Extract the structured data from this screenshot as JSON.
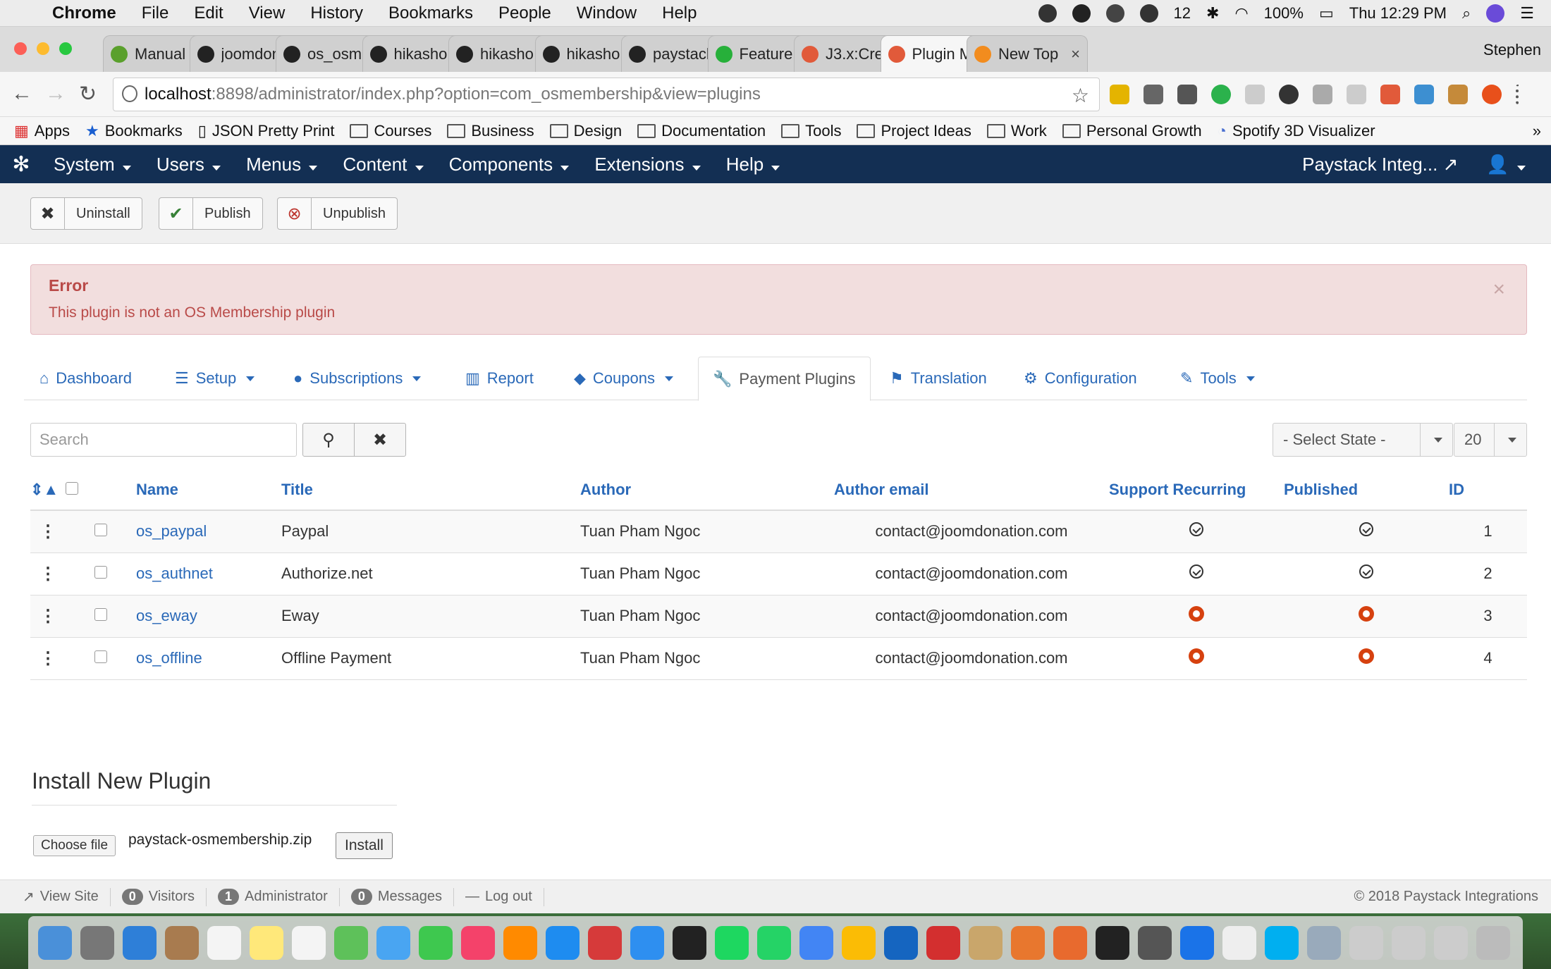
{
  "menubar": {
    "app": "Chrome",
    "items": [
      "File",
      "Edit",
      "View",
      "History",
      "Bookmarks",
      "People",
      "Window",
      "Help"
    ],
    "notification_count": "12",
    "battery": "100%",
    "clock": "Thu 12:29 PM"
  },
  "tabs": [
    {
      "label": "Manual",
      "icon": "leaf-icon"
    },
    {
      "label": "joomdon",
      "icon": "github-icon"
    },
    {
      "label": "os_osm",
      "icon": "github-icon"
    },
    {
      "label": "hikasho",
      "icon": "github-icon"
    },
    {
      "label": "hikasho",
      "icon": "github-icon"
    },
    {
      "label": "hikasho",
      "icon": "github-icon"
    },
    {
      "label": "paystack",
      "icon": "github-icon"
    },
    {
      "label": "Feature",
      "icon": "bulb-icon"
    },
    {
      "label": "J3.x:Cre",
      "icon": "joomla-icon"
    },
    {
      "label": "Plugin M",
      "icon": "joomla-icon",
      "active": true
    },
    {
      "label": "New Top",
      "icon": "os-icon"
    }
  ],
  "profile_name": "Stephen",
  "address": {
    "host": "localhost",
    "path": ":8898/administrator/index.php?option=com_osmembership&view=plugins"
  },
  "bookmarks": [
    "Apps",
    "Bookmarks",
    "JSON Pretty Print",
    "Courses",
    "Business",
    "Design",
    "Documentation",
    "Tools",
    "Project Ideas",
    "Work",
    "Personal Growth",
    "Spotify 3D Visualizer"
  ],
  "jnav": {
    "items": [
      "System",
      "Users",
      "Menus",
      "Content",
      "Components",
      "Extensions",
      "Help"
    ],
    "site_link": "Paystack Integ..."
  },
  "toolbar": {
    "uninstall": "Uninstall",
    "publish": "Publish",
    "unpublish": "Unpublish"
  },
  "alert": {
    "title": "Error",
    "message": "This plugin is not an OS Membership plugin"
  },
  "subnav": [
    {
      "label": "Dashboard",
      "icon": "home-icon",
      "dropdown": false
    },
    {
      "label": "Setup",
      "icon": "list-icon",
      "dropdown": true
    },
    {
      "label": "Subscriptions",
      "icon": "user-icon",
      "dropdown": true
    },
    {
      "label": "Report",
      "icon": "bar-chart-icon",
      "dropdown": false
    },
    {
      "label": "Coupons",
      "icon": "tag-icon",
      "dropdown": true
    },
    {
      "label": "Payment Plugins",
      "icon": "wrench-icon",
      "dropdown": false,
      "active": true
    },
    {
      "label": "Translation",
      "icon": "flag-icon",
      "dropdown": false
    },
    {
      "label": "Configuration",
      "icon": "gear-icon",
      "dropdown": false
    },
    {
      "label": "Tools",
      "icon": "tools-icon",
      "dropdown": true
    }
  ],
  "filters": {
    "search_placeholder": "Search",
    "state": "- Select State -",
    "limit": "20"
  },
  "table": {
    "headers": {
      "name": "Name",
      "title": "Title",
      "author": "Author",
      "email": "Author email",
      "recurring": "Support Recurring",
      "published": "Published",
      "id": "ID"
    },
    "rows": [
      {
        "name": "os_paypal",
        "title": "Paypal",
        "author": "Tuan Pham Ngoc",
        "email": "contact@joomdonation.com",
        "recurring": true,
        "published": true,
        "id": "1"
      },
      {
        "name": "os_authnet",
        "title": "Authorize.net",
        "author": "Tuan Pham Ngoc",
        "email": "contact@joomdonation.com",
        "recurring": true,
        "published": true,
        "id": "2"
      },
      {
        "name": "os_eway",
        "title": "Eway",
        "author": "Tuan Pham Ngoc",
        "email": "contact@joomdonation.com",
        "recurring": false,
        "published": false,
        "id": "3"
      },
      {
        "name": "os_offline",
        "title": "Offline Payment",
        "author": "Tuan Pham Ngoc",
        "email": "contact@joomdonation.com",
        "recurring": false,
        "published": false,
        "id": "4"
      }
    ]
  },
  "install": {
    "title": "Install New Plugin",
    "choose_file": "Choose file",
    "file_name": "paystack-osmembership.zip",
    "install_btn": "Install"
  },
  "statusbar": {
    "view_site": "View Site",
    "visitors_count": "0",
    "visitors": "Visitors",
    "admin_count": "1",
    "admin": "Administrator",
    "messages_count": "0",
    "messages": "Messages",
    "logout": "Log out",
    "copyright": "© 2018 Paystack Integrations"
  },
  "colors": {
    "joomla_nav": "#132f53",
    "link": "#2a69b8",
    "error_bg": "#f2dede",
    "error_text": "#b94a48",
    "unpublished": "#d6410f"
  }
}
